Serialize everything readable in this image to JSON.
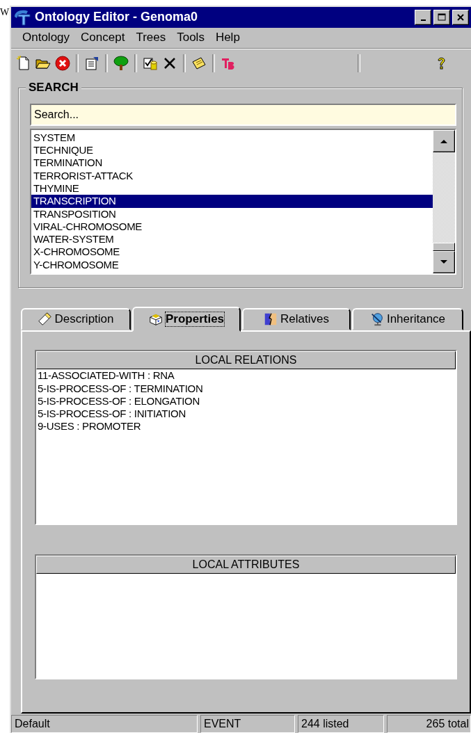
{
  "backdrop_text": "W",
  "window": {
    "title": "Ontology Editor - Genoma0"
  },
  "menu": [
    "Ontology",
    "Concept",
    "Trees",
    "Tools",
    "Help"
  ],
  "toolbar": [
    {
      "kind": "new"
    },
    {
      "kind": "open"
    },
    {
      "kind": "delete"
    },
    {
      "kind": "sep"
    },
    {
      "kind": "properties"
    },
    {
      "kind": "sep"
    },
    {
      "kind": "tree"
    },
    {
      "kind": "sep"
    },
    {
      "kind": "check"
    },
    {
      "kind": "cross"
    },
    {
      "kind": "sep"
    },
    {
      "kind": "note"
    },
    {
      "kind": "sep"
    },
    {
      "kind": "tb"
    },
    {
      "kind": "wide-sep"
    },
    {
      "kind": "help"
    }
  ],
  "search": {
    "title": "SEARCH",
    "placeholder": "Search...",
    "items": [
      {
        "label": "SYSTEM",
        "selected": false
      },
      {
        "label": "TECHNIQUE",
        "selected": false
      },
      {
        "label": "TERMINATION",
        "selected": false
      },
      {
        "label": "TERRORIST-ATTACK",
        "selected": false
      },
      {
        "label": "THYMINE",
        "selected": false
      },
      {
        "label": "TRANSCRIPTION",
        "selected": true
      },
      {
        "label": "TRANSPOSITION",
        "selected": false
      },
      {
        "label": "VIRAL-CHROMOSOME",
        "selected": false
      },
      {
        "label": "WATER-SYSTEM",
        "selected": false
      },
      {
        "label": "X-CHROMOSOME",
        "selected": false
      },
      {
        "label": "Y-CHROMOSOME",
        "selected": false
      }
    ]
  },
  "tabs": [
    {
      "label": "Description",
      "kind": "description",
      "selected": false
    },
    {
      "label": "Properties",
      "kind": "properties",
      "selected": true
    },
    {
      "label": "Relatives",
      "kind": "relatives",
      "selected": false
    },
    {
      "label": "Inheritance",
      "kind": "inheritance",
      "selected": false
    }
  ],
  "local_relations": {
    "title": "LOCAL RELATIONS",
    "items": [
      "11-ASSOCIATED-WITH : RNA",
      "5-IS-PROCESS-OF : TERMINATION",
      "5-IS-PROCESS-OF : ELONGATION",
      "5-IS-PROCESS-OF : INITIATION",
      "9-USES : PROMOTER"
    ]
  },
  "local_attributes": {
    "title": "LOCAL ATTRIBUTES"
  },
  "status_bar": [
    "Default",
    "EVENT",
    "244 listed",
    "265 total"
  ]
}
